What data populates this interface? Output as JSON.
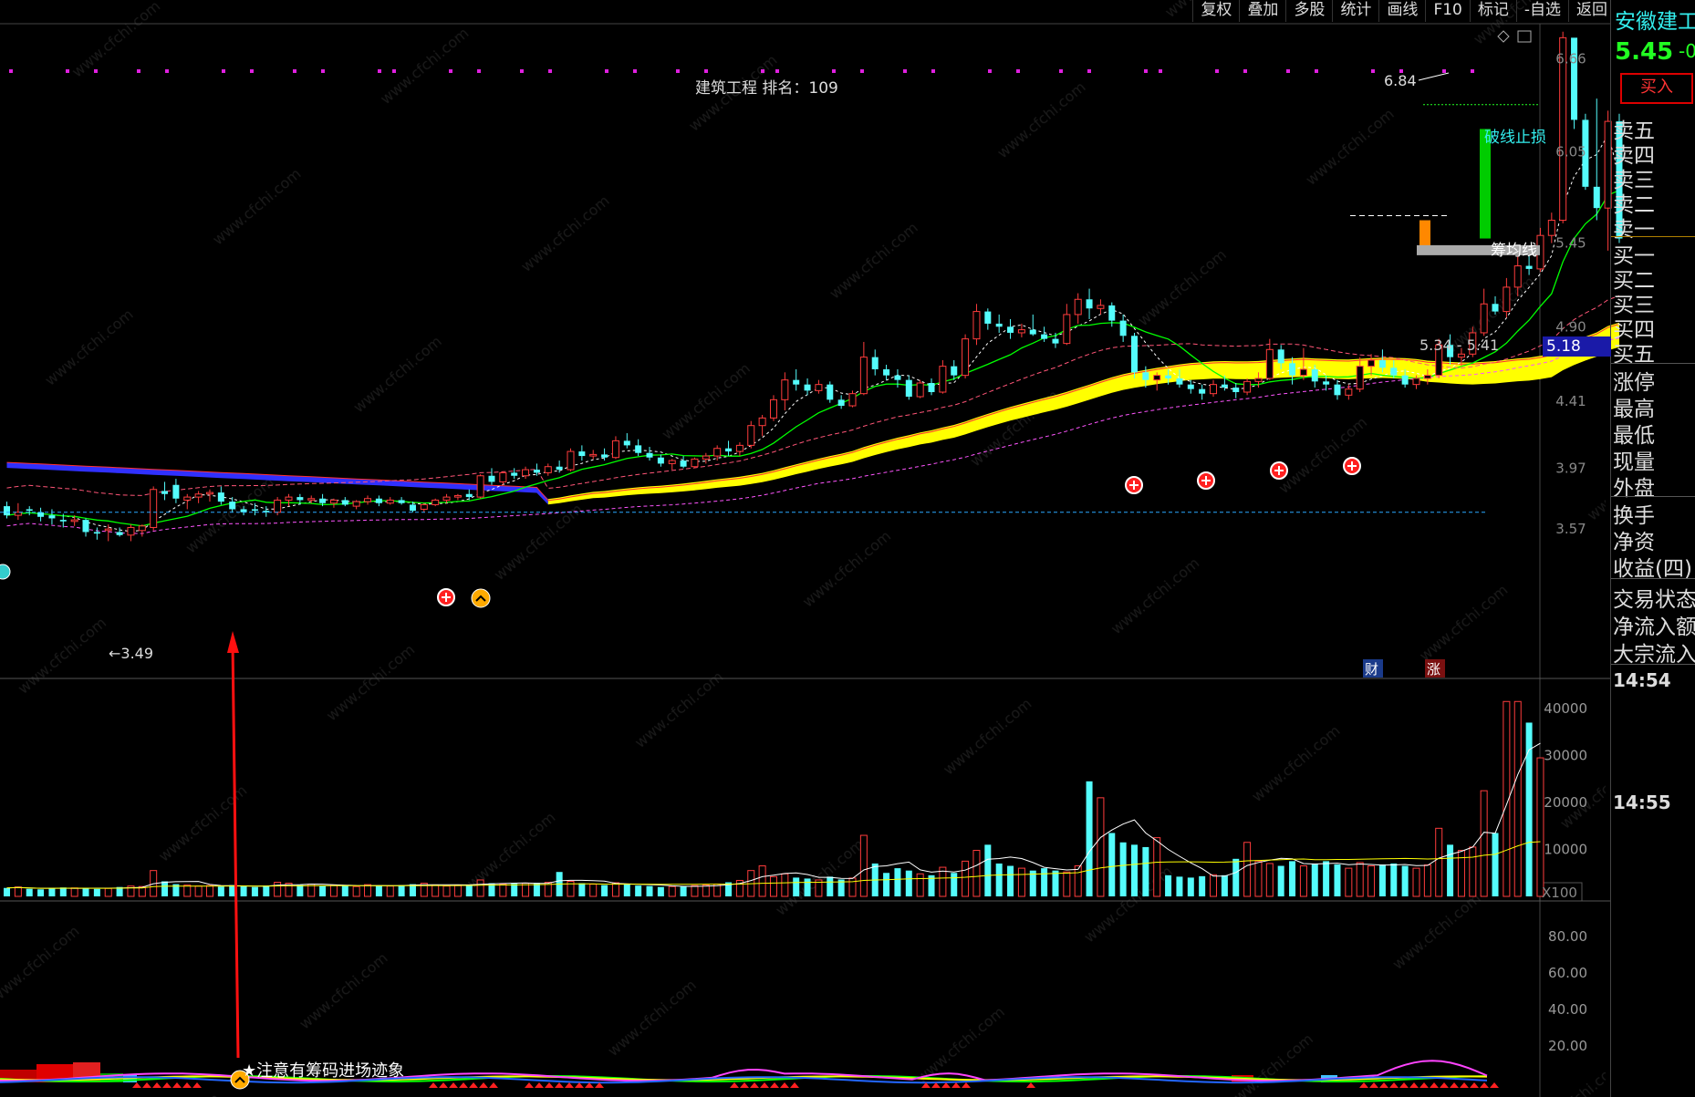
{
  "toolbar": {
    "items": [
      "复权",
      "叠加",
      "多股",
      "统计",
      "画线",
      "F10",
      "标记",
      "-自选",
      "返回"
    ]
  },
  "chart_title": "建筑工程 排名：109",
  "stock": {
    "name": "安徽建工",
    "price": "5.45",
    "change_partial": "-0",
    "buy_label": "买入"
  },
  "price_axis": [
    "6.66",
    "6.05",
    "5.45",
    "4.90",
    "4.41",
    "3.97",
    "3.57"
  ],
  "price_marker": "5.18",
  "volume_axis": [
    "40000",
    "30000",
    "20000",
    "10000"
  ],
  "volume_unit": "X100",
  "indicator_axis": [
    "80.00",
    "60.00",
    "40.00",
    "20.00"
  ],
  "annotations": {
    "high": "6.84",
    "low": "3.49",
    "stop_line": "破线止损",
    "cost_line": "筹均线",
    "range": "5.34 - 5.41",
    "badge_cai": "财",
    "badge_zhang": "涨",
    "chip_note": "★注意有筹码进场迹象"
  },
  "order_book": [
    "卖五",
    "卖四",
    "卖三",
    "卖二",
    "卖一",
    "买一",
    "买二",
    "买三",
    "买四",
    "买五"
  ],
  "quote_fields": [
    "涨停",
    "最高",
    "最低",
    "现量",
    "外盘"
  ],
  "stats_fields": [
    "换手",
    "净资",
    "收益(四)"
  ],
  "status_fields": [
    "交易状态",
    "净流入额",
    "大宗流入"
  ],
  "times": [
    "14:54",
    "14:55"
  ],
  "colors": {
    "up": "#ff3c3c",
    "down": "#54fcfc",
    "ma_fast": "#00ff00",
    "band": "#ffff00",
    "band_before": "#3030ff",
    "ma_long": "#ff55ff",
    "dash_ref": "#2aa7ff"
  },
  "chart_data": [
    {
      "type": "candlestick",
      "title": "建筑工程 排名：109",
      "ylim": [
        3.4,
        6.9
      ],
      "y_ticks": [
        6.66,
        6.05,
        5.45,
        4.9,
        4.41,
        3.97,
        3.57
      ],
      "high": 6.84,
      "low": 3.49,
      "ohlc": [
        [
          3.72,
          3.75,
          3.64,
          3.66
        ],
        [
          3.66,
          3.74,
          3.63,
          3.68
        ],
        [
          3.7,
          3.72,
          3.66,
          3.69
        ],
        [
          3.68,
          3.71,
          3.62,
          3.65
        ],
        [
          3.66,
          3.7,
          3.6,
          3.64
        ],
        [
          3.63,
          3.67,
          3.58,
          3.62
        ],
        [
          3.62,
          3.66,
          3.59,
          3.63
        ],
        [
          3.63,
          3.64,
          3.52,
          3.55
        ],
        [
          3.55,
          3.58,
          3.5,
          3.54
        ],
        [
          3.56,
          3.6,
          3.49,
          3.57
        ],
        [
          3.55,
          3.58,
          3.52,
          3.53
        ],
        [
          3.53,
          3.6,
          3.49,
          3.58
        ],
        [
          3.56,
          3.6,
          3.52,
          3.59
        ],
        [
          3.58,
          3.85,
          3.56,
          3.83
        ],
        [
          3.82,
          3.88,
          3.76,
          3.8
        ],
        [
          3.86,
          3.9,
          3.74,
          3.77
        ],
        [
          3.76,
          3.8,
          3.7,
          3.78
        ],
        [
          3.78,
          3.82,
          3.74,
          3.8
        ],
        [
          3.8,
          3.83,
          3.75,
          3.81
        ],
        [
          3.81,
          3.85,
          3.73,
          3.75
        ],
        [
          3.75,
          3.78,
          3.68,
          3.7
        ],
        [
          3.7,
          3.72,
          3.66,
          3.68
        ],
        [
          3.7,
          3.74,
          3.66,
          3.69
        ],
        [
          3.69,
          3.72,
          3.65,
          3.68
        ],
        [
          3.68,
          3.78,
          3.66,
          3.76
        ],
        [
          3.76,
          3.8,
          3.72,
          3.78
        ],
        [
          3.78,
          3.8,
          3.73,
          3.76
        ],
        [
          3.76,
          3.79,
          3.74,
          3.77
        ],
        [
          3.77,
          3.8,
          3.72,
          3.74
        ],
        [
          3.74,
          3.77,
          3.71,
          3.76
        ],
        [
          3.76,
          3.78,
          3.72,
          3.73
        ],
        [
          3.72,
          3.76,
          3.7,
          3.75
        ],
        [
          3.75,
          3.79,
          3.73,
          3.77
        ],
        [
          3.77,
          3.79,
          3.72,
          3.74
        ],
        [
          3.74,
          3.78,
          3.73,
          3.76
        ],
        [
          3.76,
          3.78,
          3.73,
          3.74
        ],
        [
          3.73,
          3.75,
          3.68,
          3.69
        ],
        [
          3.7,
          3.74,
          3.68,
          3.73
        ],
        [
          3.73,
          3.77,
          3.72,
          3.76
        ],
        [
          3.76,
          3.8,
          3.74,
          3.78
        ],
        [
          3.78,
          3.8,
          3.76,
          3.79
        ],
        [
          3.8,
          3.83,
          3.76,
          3.78
        ],
        [
          3.78,
          3.93,
          3.77,
          3.92
        ],
        [
          3.92,
          3.97,
          3.86,
          3.88
        ],
        [
          3.88,
          3.95,
          3.86,
          3.94
        ],
        [
          3.94,
          3.97,
          3.9,
          3.92
        ],
        [
          3.92,
          3.98,
          3.9,
          3.96
        ],
        [
          3.96,
          4.0,
          3.92,
          3.94
        ],
        [
          3.94,
          4.0,
          3.92,
          3.98
        ],
        [
          3.98,
          4.02,
          3.94,
          3.96
        ],
        [
          3.96,
          4.1,
          3.95,
          4.08
        ],
        [
          4.08,
          4.12,
          4.02,
          4.05
        ],
        [
          4.05,
          4.09,
          4.03,
          4.06
        ],
        [
          4.06,
          4.1,
          4.02,
          4.04
        ],
        [
          4.04,
          4.18,
          4.03,
          4.15
        ],
        [
          4.15,
          4.2,
          4.1,
          4.12
        ],
        [
          4.12,
          4.16,
          4.05,
          4.07
        ],
        [
          4.07,
          4.11,
          4.02,
          4.04
        ],
        [
          4.04,
          4.06,
          3.98,
          4.0
        ],
        [
          4.0,
          4.03,
          3.96,
          4.02
        ],
        [
          4.02,
          4.05,
          3.97,
          3.98
        ],
        [
          3.98,
          4.04,
          3.97,
          4.03
        ],
        [
          4.03,
          4.07,
          4.0,
          4.05
        ],
        [
          4.05,
          4.12,
          4.02,
          4.1
        ],
        [
          4.1,
          4.15,
          4.05,
          4.08
        ],
        [
          4.08,
          4.14,
          4.05,
          4.12
        ],
        [
          4.12,
          4.28,
          4.1,
          4.25
        ],
        [
          4.25,
          4.32,
          4.18,
          4.3
        ],
        [
          4.3,
          4.45,
          4.28,
          4.42
        ],
        [
          4.42,
          4.6,
          4.35,
          4.55
        ],
        [
          4.55,
          4.62,
          4.48,
          4.52
        ],
        [
          4.52,
          4.56,
          4.45,
          4.48
        ],
        [
          4.48,
          4.55,
          4.46,
          4.52
        ],
        [
          4.52,
          4.54,
          4.4,
          4.42
        ],
        [
          4.42,
          4.45,
          4.36,
          4.38
        ],
        [
          4.38,
          4.48,
          4.37,
          4.46
        ],
        [
          4.46,
          4.8,
          4.45,
          4.7
        ],
        [
          4.7,
          4.75,
          4.58,
          4.62
        ],
        [
          4.62,
          4.65,
          4.55,
          4.58
        ],
        [
          4.58,
          4.62,
          4.5,
          4.55
        ],
        [
          4.55,
          4.58,
          4.42,
          4.44
        ],
        [
          4.44,
          4.55,
          4.43,
          4.53
        ],
        [
          4.53,
          4.56,
          4.45,
          4.47
        ],
        [
          4.47,
          4.68,
          4.46,
          4.64
        ],
        [
          4.64,
          4.68,
          4.55,
          4.58
        ],
        [
          4.58,
          4.85,
          4.56,
          4.82
        ],
        [
          4.82,
          5.05,
          4.78,
          5.0
        ],
        [
          5.0,
          5.02,
          4.88,
          4.92
        ],
        [
          4.92,
          4.98,
          4.86,
          4.9
        ],
        [
          4.9,
          4.95,
          4.82,
          4.86
        ],
        [
          4.86,
          4.92,
          4.83,
          4.88
        ],
        [
          4.88,
          4.98,
          4.84,
          4.85
        ],
        [
          4.85,
          4.9,
          4.8,
          4.82
        ],
        [
          4.82,
          4.86,
          4.76,
          4.79
        ],
        [
          4.79,
          5.05,
          4.78,
          4.98
        ],
        [
          4.98,
          5.12,
          4.92,
          5.08
        ],
        [
          5.08,
          5.15,
          4.95,
          5.02
        ],
        [
          5.02,
          5.08,
          4.98,
          5.04
        ],
        [
          5.04,
          5.06,
          4.9,
          4.94
        ],
        [
          4.94,
          4.98,
          4.8,
          4.84
        ],
        [
          4.84,
          4.86,
          4.56,
          4.6
        ],
        [
          4.6,
          4.64,
          4.5,
          4.55
        ],
        [
          4.55,
          4.6,
          4.48,
          4.58
        ],
        [
          4.58,
          4.62,
          4.52,
          4.56
        ],
        [
          4.56,
          4.62,
          4.5,
          4.52
        ],
        [
          4.52,
          4.55,
          4.46,
          4.49
        ],
        [
          4.49,
          4.52,
          4.42,
          4.46
        ],
        [
          4.46,
          4.55,
          4.44,
          4.52
        ],
        [
          4.52,
          4.58,
          4.48,
          4.5
        ],
        [
          4.5,
          4.53,
          4.43,
          4.47
        ],
        [
          4.47,
          4.56,
          4.45,
          4.54
        ],
        [
          4.54,
          4.6,
          4.5,
          4.56
        ],
        [
          4.56,
          4.82,
          4.55,
          4.75
        ],
        [
          4.75,
          4.78,
          4.62,
          4.66
        ],
        [
          4.66,
          4.7,
          4.52,
          4.58
        ],
        [
          4.58,
          4.76,
          4.55,
          4.62
        ],
        [
          4.62,
          4.65,
          4.5,
          4.54
        ],
        [
          4.54,
          4.58,
          4.48,
          4.52
        ],
        [
          4.52,
          4.55,
          4.42,
          4.45
        ],
        [
          4.45,
          4.52,
          4.42,
          4.49
        ],
        [
          4.49,
          4.7,
          4.47,
          4.64
        ],
        [
          4.64,
          4.72,
          4.58,
          4.68
        ],
        [
          4.68,
          4.75,
          4.6,
          4.63
        ],
        [
          4.63,
          4.68,
          4.56,
          4.58
        ],
        [
          4.58,
          4.62,
          4.5,
          4.52
        ],
        [
          4.52,
          4.58,
          4.49,
          4.56
        ],
        [
          4.56,
          4.62,
          4.52,
          4.58
        ],
        [
          4.58,
          4.82,
          4.56,
          4.78
        ],
        [
          4.78,
          4.85,
          4.65,
          4.7
        ],
        [
          4.7,
          4.76,
          4.64,
          4.72
        ],
        [
          4.72,
          4.9,
          4.7,
          4.86
        ],
        [
          4.86,
          5.15,
          4.84,
          5.05
        ],
        [
          5.05,
          5.1,
          4.98,
          5.0
        ],
        [
          5.0,
          5.22,
          4.96,
          5.16
        ],
        [
          5.16,
          5.36,
          5.1,
          5.3
        ],
        [
          5.3,
          5.42,
          5.24,
          5.28
        ],
        [
          5.28,
          5.55,
          5.26,
          5.5
        ],
        [
          5.5,
          5.65,
          5.45,
          5.6
        ],
        [
          5.6,
          6.84,
          5.58,
          6.8
        ],
        [
          6.8,
          6.5,
          6.2,
          6.26
        ],
        [
          6.26,
          6.3,
          5.8,
          5.82
        ],
        [
          5.82,
          6.4,
          5.6,
          5.68
        ],
        [
          5.68,
          6.32,
          5.4,
          6.25
        ],
        [
          6.25,
          6.3,
          5.45,
          5.48
        ]
      ]
    },
    {
      "type": "bar",
      "title": "",
      "unit": "X100",
      "ylim": [
        0,
        42000
      ],
      "values": [
        1800,
        2000,
        1600,
        1500,
        1700,
        1900,
        1800,
        1700,
        1600,
        1700,
        2000,
        2200,
        2100,
        5500,
        3200,
        2600,
        2400,
        2200,
        2300,
        2100,
        2400,
        2200,
        2000,
        2300,
        3000,
        2800,
        2400,
        2600,
        2200,
        2400,
        2300,
        2100,
        2500,
        2300,
        2200,
        2400,
        2600,
        2800,
        2400,
        2200,
        2300,
        2500,
        3500,
        2800,
        2600,
        2700,
        2800,
        2900,
        3000,
        5200,
        3200,
        2800,
        2600,
        2400,
        2900,
        2700,
        2300,
        2200,
        2000,
        2100,
        2100,
        2300,
        2400,
        2600,
        3000,
        3400,
        5500,
        6500,
        4200,
        4800,
        4000,
        3800,
        3500,
        4200,
        3600,
        3900,
        13000,
        7000,
        5000,
        6000,
        5500,
        4800,
        4500,
        6200,
        5000,
        7500,
        9800,
        11000,
        7000,
        6500,
        6000,
        5500,
        6000,
        5500,
        5200,
        6500,
        24500,
        21000,
        13500,
        11500,
        11000,
        10500,
        12500,
        4500,
        4200,
        4000,
        4300,
        4600,
        4500,
        8000,
        11500,
        7500,
        7000,
        6500,
        7500,
        6500,
        7000,
        7500,
        6800,
        6000,
        7200,
        6500,
        6800,
        7000,
        6500,
        6000,
        6700,
        14500,
        11000,
        9800,
        10500,
        22500,
        13500,
        41500,
        41500,
        37000,
        29500
      ],
      "ma5_note": "white and yellow averages"
    },
    {
      "type": "area",
      "title": "",
      "ylim": [
        0,
        100
      ],
      "y_ticks": [
        80,
        60,
        40,
        20
      ]
    }
  ]
}
